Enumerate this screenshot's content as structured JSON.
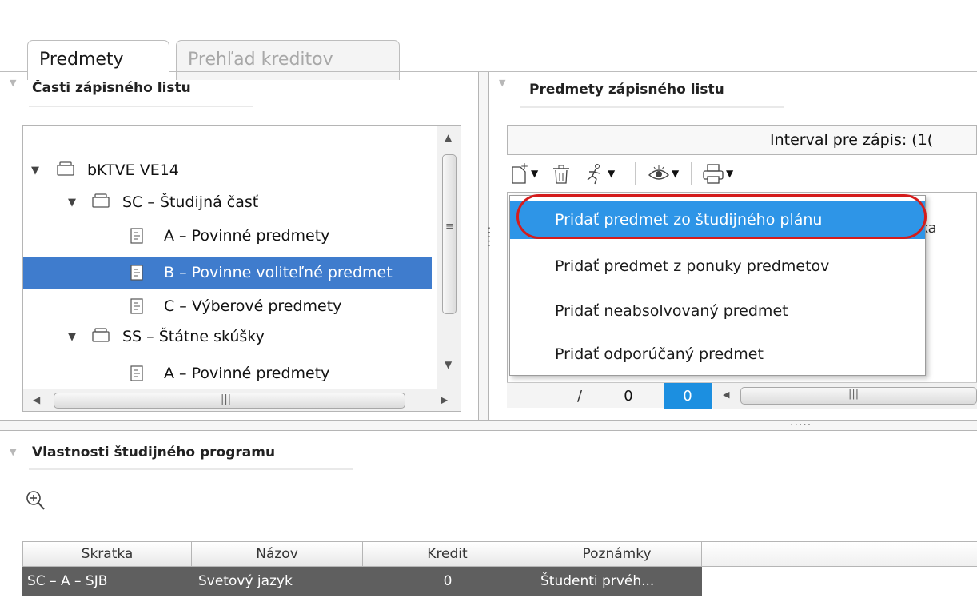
{
  "tabs": [
    {
      "label": "Predmety",
      "active": true
    },
    {
      "label": "Prehľad kreditov",
      "active": false
    }
  ],
  "left_panel": {
    "title": "Časti zápisného listu",
    "tree": [
      {
        "label": "bKTVE VE14",
        "icon": "folder-icon",
        "expanded": true,
        "level": 0
      },
      {
        "label": "SC – Študijná časť",
        "icon": "folder-icon",
        "expanded": true,
        "level": 1
      },
      {
        "label": "A – Povinné predmety",
        "icon": "document-icon",
        "level": 2
      },
      {
        "label": "B – Povinne voliteľné predmet",
        "icon": "document-icon",
        "level": 2,
        "selected": true
      },
      {
        "label": "C – Výberové predmety",
        "icon": "document-icon",
        "level": 2
      },
      {
        "label": "SS – Štátne skúšky",
        "icon": "folder-icon",
        "expanded": true,
        "level": 1
      },
      {
        "label": "A – Povinné predmety",
        "icon": "document-icon",
        "level": 2
      }
    ]
  },
  "right_panel": {
    "title": "Predmety zápisného listu",
    "interval_text": "Interval pre zápis: (1(",
    "toolbar": [
      {
        "icon": "new-document-icon",
        "dropdown": true
      },
      {
        "icon": "trash-icon",
        "dropdown": false
      },
      {
        "icon": "runner-icon",
        "dropdown": true
      },
      {
        "icon": "eye-icon",
        "dropdown": true
      },
      {
        "icon": "printer-icon",
        "dropdown": true
      }
    ],
    "grid_header_partial": "ratka",
    "pager": {
      "separator": "/",
      "total": "0",
      "current": "0"
    }
  },
  "context_menu": {
    "items": [
      {
        "label": "Pridať  predmet zo študijného plánu",
        "highlighted": true
      },
      {
        "label": "Pridať  predmet z ponuky predmetov",
        "highlighted": false
      },
      {
        "label": "Pridať  neabsolvovaný predmet",
        "highlighted": false
      },
      {
        "label": "Pridať  odporúčaný predmet",
        "highlighted": false
      }
    ],
    "highlight_color": "#2e95e7",
    "annotation_color": "#d41c1c"
  },
  "bottom_panel": {
    "title": "Vlastnosti študijného programu",
    "table": {
      "columns": [
        "Skratka",
        "Názov",
        "Kredit",
        "Poznámky"
      ],
      "rows": [
        [
          "SC – A – SJB",
          "Svetový jazyk",
          "0",
          "Študenti prvéh..."
        ]
      ]
    }
  },
  "colors": {
    "selection": "#3f7ccd",
    "pager_selected": "#1c8fe0",
    "row_dark": "#5f5f5f"
  }
}
